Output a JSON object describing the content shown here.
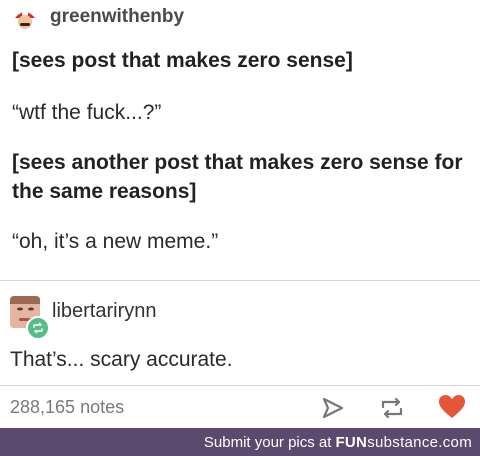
{
  "post": {
    "user": "greenwithenby",
    "lines": [
      "[sees post that makes zero sense]",
      "“wtf the fuck...?”",
      "[sees another post that makes zero sense for",
      "the same reasons]",
      "“oh, it’s a new meme.”"
    ]
  },
  "reblog": {
    "user": "libertarirynn",
    "comment": "That’s... scary accurate."
  },
  "footer": {
    "notes": "288,165 notes",
    "icons": [
      "share-icon",
      "reblog-icon",
      "heart-icon"
    ],
    "heart_color": "#e2563a"
  },
  "banner": {
    "text": "Submit your pics at",
    "brand_bold": "FUN",
    "brand_rest": "substance",
    "brand_tld": ".com",
    "background": "#5b4a6e"
  }
}
